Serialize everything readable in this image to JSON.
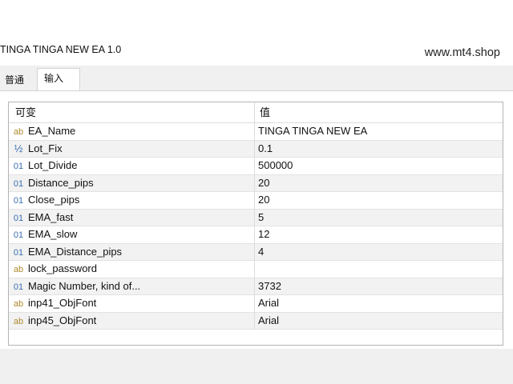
{
  "window": {
    "title": "TINGA TINGA NEW EA 1.0",
    "watermark": "www.mt4.shop"
  },
  "tabs": [
    {
      "label": "普通",
      "active": false
    },
    {
      "label": "输入",
      "active": true
    }
  ],
  "grid": {
    "headers": {
      "name": "可变",
      "value": "值"
    },
    "rows": [
      {
        "icon": "ab",
        "name": "EA_Name",
        "value": "TINGA TINGA NEW EA"
      },
      {
        "icon": "½",
        "name": "Lot_Fix",
        "value": "0.1"
      },
      {
        "icon": "01",
        "name": "Lot_Divide",
        "value": "500000"
      },
      {
        "icon": "01",
        "name": "Distance_pips",
        "value": "20"
      },
      {
        "icon": "01",
        "name": "Close_pips",
        "value": "20"
      },
      {
        "icon": "01",
        "name": "EMA_fast",
        "value": "5"
      },
      {
        "icon": "01",
        "name": "EMA_slow",
        "value": "12"
      },
      {
        "icon": "01",
        "name": "EMA_Distance_pips",
        "value": "4"
      },
      {
        "icon": "ab",
        "name": "lock_password",
        "value": ""
      },
      {
        "icon": "01",
        "name": "Magic Number, kind of...",
        "value": "3732"
      },
      {
        "icon": "ab",
        "name": "inp41_ObjFont",
        "value": "Arial"
      },
      {
        "icon": "ab",
        "name": "inp45_ObjFont",
        "value": "Arial"
      }
    ]
  }
}
